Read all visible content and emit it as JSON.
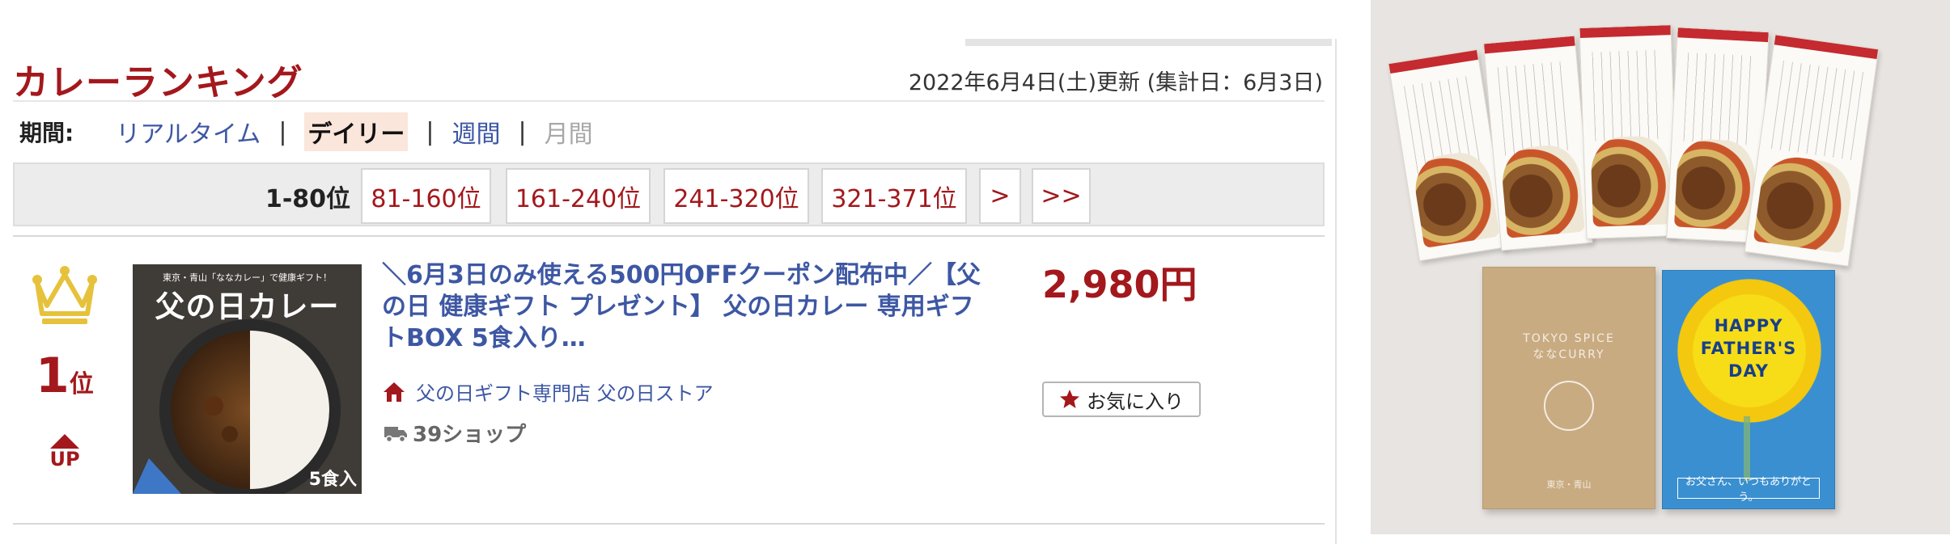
{
  "ranking": {
    "title": "カレーランキング",
    "updated": "2022年6月4日(土)更新 (集計日：6月3日)",
    "period": {
      "label": "期間:",
      "items": [
        "リアルタイム",
        "デイリー",
        "週間",
        "月間"
      ],
      "active": "デイリー",
      "separator": "|"
    },
    "pagination": {
      "current": "1-80位",
      "pages": [
        "81-160位",
        "161-240位",
        "241-320位",
        "321-371位",
        ">",
        ">>"
      ]
    },
    "item": {
      "rank_number": "1",
      "rank_suffix": "位",
      "trend": "UP",
      "image_caption": "東京・青山「ななカレー」で健康ギフト！",
      "image_title": "父の日カレー",
      "image_qty": "5食入",
      "title": "＼6月3日のみ使える500円OFFクーポン配布中／【父の日 健康ギフト プレゼント】 父の日カレー 専用ギフトBOX 5食入り…",
      "shop_name": "父の日ギフト専門店 父の日ストア",
      "shop_count": "39ショップ",
      "price": "2,980円",
      "favorite_label": "お気に入り"
    }
  },
  "photo": {
    "box_brand_line1": "TOKYO SPICE",
    "box_brand_line2": "ななCURRY",
    "box_location": "東京・青山",
    "card_message_line1": "HAPPY",
    "card_message_line2": "FATHER'S",
    "card_message_line3": "DAY",
    "card_footer": "お父さん、いつもありがとう。"
  },
  "colors": {
    "accent_red": "#a3181c",
    "link_blue": "#3d57a3",
    "crown_gold": "#e6c23c",
    "active_tab_bg": "#fbe6dc"
  },
  "icons": [
    "crown-icon",
    "house-icon",
    "truck-icon",
    "star-icon",
    "up-arrow-icon"
  ]
}
